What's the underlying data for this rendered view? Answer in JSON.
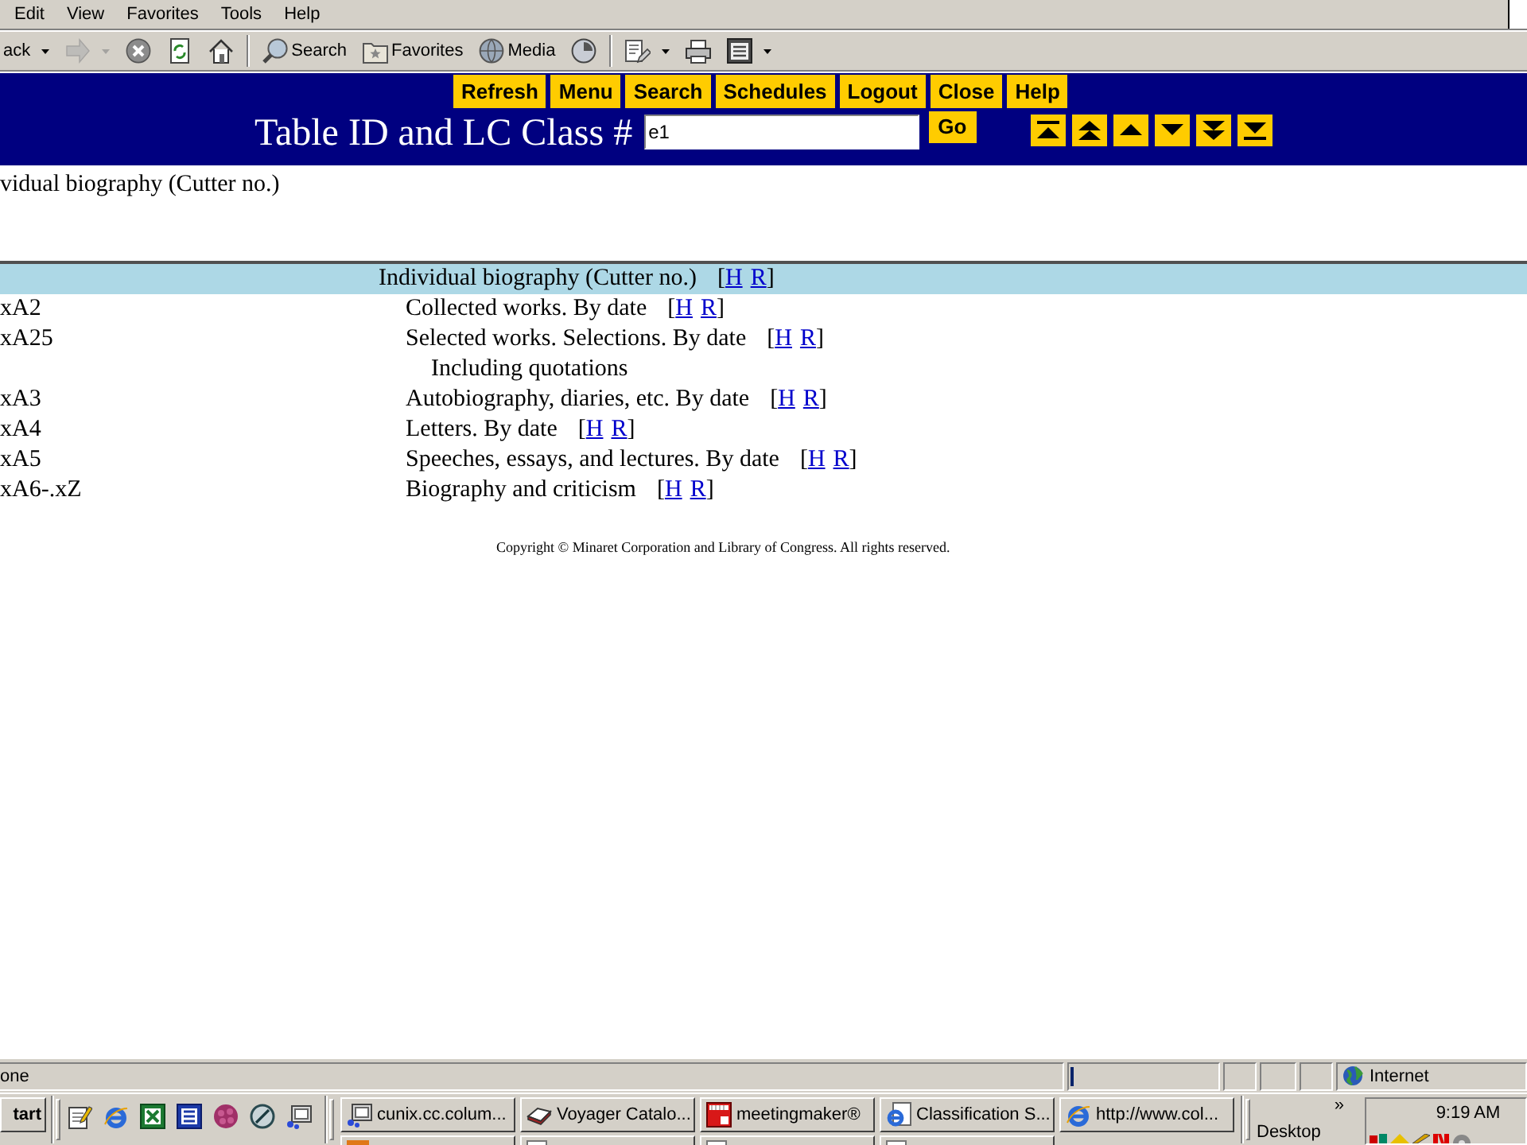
{
  "menu_bar": {
    "items": [
      "Edit",
      "View",
      "Favorites",
      "Tools",
      "Help"
    ]
  },
  "toolbar": {
    "groups": [
      [
        {
          "kind": "back",
          "label": "ack",
          "dropdown": true,
          "disabled": false
        },
        {
          "kind": "forward",
          "dropdown": true,
          "disabled": true
        },
        {
          "kind": "stop",
          "dropdown": false,
          "disabled": false
        },
        {
          "kind": "refresh",
          "dropdown": false,
          "disabled": false
        },
        {
          "kind": "home",
          "dropdown": false,
          "disabled": false
        }
      ],
      [
        {
          "kind": "search",
          "label": "Search",
          "dropdown": false,
          "disabled": false
        },
        {
          "kind": "favorites",
          "label": "Favorites",
          "dropdown": false,
          "disabled": false
        },
        {
          "kind": "media",
          "label": "Media",
          "dropdown": false,
          "disabled": false
        },
        {
          "kind": "history",
          "dropdown": false,
          "disabled": false
        }
      ],
      [
        {
          "kind": "edit",
          "dropdown": true,
          "disabled": false
        },
        {
          "kind": "print",
          "dropdown": false,
          "disabled": false
        },
        {
          "kind": "word",
          "dropdown": true,
          "disabled": false
        }
      ]
    ]
  },
  "header": {
    "nav_buttons": [
      "Refresh",
      "Menu",
      "Search",
      "Schedules",
      "Logout",
      "Close",
      "Help"
    ],
    "lookup": {
      "label": "Table ID and LC Class #",
      "value": "e1",
      "button": "Go"
    },
    "scroll_buttons": [
      {
        "kind": "first"
      },
      {
        "kind": "page_up"
      },
      {
        "kind": "up"
      },
      {
        "kind": "down"
      },
      {
        "kind": "page_down"
      },
      {
        "kind": "last"
      }
    ]
  },
  "page_heading": "vidual biography (Cutter no.)",
  "table": {
    "heading": {
      "caption": "Individual biography (Cutter no.)",
      "links": {
        "open": "[",
        "items": [
          "H",
          "R"
        ],
        "close": "]"
      }
    },
    "rows": [
      {
        "kind": "entry",
        "number": "xA2",
        "caption": "Collected works. By date",
        "links": {
          "open": "[",
          "items": [
            "H",
            "R"
          ],
          "close": "]"
        }
      },
      {
        "kind": "entry",
        "number": "xA25",
        "caption": "Selected works. Selections. By date",
        "links": {
          "open": "[",
          "items": [
            "H",
            "R"
          ],
          "close": "]"
        }
      },
      {
        "kind": "note",
        "caption": "Including quotations"
      },
      {
        "kind": "entry",
        "number": "xA3",
        "caption": "Autobiography, diaries, etc. By date",
        "links": {
          "open": "[",
          "items": [
            "H",
            "R"
          ],
          "close": "]"
        }
      },
      {
        "kind": "entry",
        "number": "xA4",
        "caption": "Letters. By date",
        "links": {
          "open": "[",
          "items": [
            "H",
            "R"
          ],
          "close": "]"
        }
      },
      {
        "kind": "entry",
        "number": "xA5",
        "caption": "Speeches, essays, and lectures. By date",
        "links": {
          "open": "[",
          "items": [
            "H",
            "R"
          ],
          "close": "]"
        }
      },
      {
        "kind": "entry",
        "number": "xA6-.xZ",
        "caption": "Biography and criticism",
        "links": {
          "open": "[",
          "items": [
            "H",
            "R"
          ],
          "close": "]"
        }
      }
    ]
  },
  "copyright": "Copyright © Minaret Corporation and Library of Congress. All rights reserved.",
  "status_bar": {
    "text": "one",
    "progress": {
      "level": 0.02
    },
    "zone": "Internet"
  },
  "taskbar": {
    "start": "tart",
    "quick_launch": [
      {
        "kind": "notepad"
      },
      {
        "kind": "browser"
      },
      {
        "kind": "spreadsheet"
      },
      {
        "kind": "wordprocessor"
      },
      {
        "kind": "flower"
      },
      {
        "kind": "navigator"
      },
      {
        "kind": "terminal"
      }
    ],
    "tasks": [
      {
        "label": "cunix.cc.colum...",
        "kind": "terminal"
      },
      {
        "label": "Voyager Catalo...",
        "kind": "book"
      },
      {
        "label": "meetingmaker®",
        "kind": "calendar"
      },
      {
        "label": "Classification S...",
        "kind": "browser_page"
      },
      {
        "label": "http://www.col...",
        "kind": "browser"
      }
    ],
    "second_row": [
      {
        "kind": "square"
      },
      {
        "kind": "page"
      },
      {
        "kind": "page"
      },
      {
        "kind": "page"
      }
    ],
    "desktop": "Desktop",
    "chevron": "»",
    "clock": "9:19 AM",
    "tray_icons": [
      {
        "kind": "network"
      },
      {
        "kind": "diamond"
      },
      {
        "kind": "pencil"
      },
      {
        "kind": "bars"
      },
      {
        "kind": "gear"
      }
    ]
  }
}
